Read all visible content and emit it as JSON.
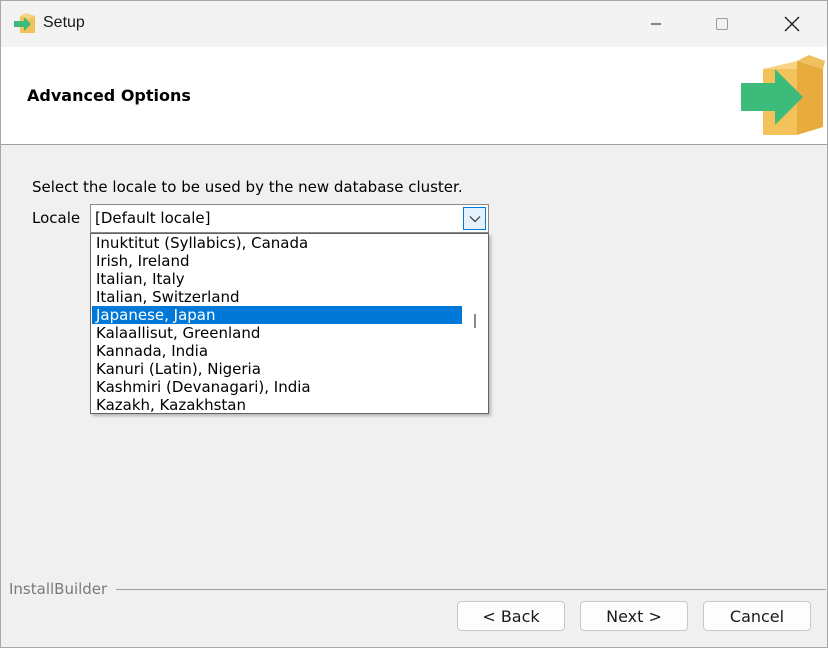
{
  "window": {
    "title": "Setup",
    "app_icon": "installer-box-arrow-icon",
    "controls": {
      "minimize": "minimize-icon",
      "maximize": "maximize-icon",
      "close": "close-icon"
    }
  },
  "header": {
    "title": "Advanced Options",
    "logo": "installer-box-arrow-logo"
  },
  "body": {
    "prompt": "Select the locale to be used by the new database cluster.",
    "locale_label": "Locale",
    "locale_value": "[Default locale]",
    "dropdown_items": [
      "Inuktitut (Syllabics), Canada",
      "Irish, Ireland",
      "Italian, Italy",
      "Italian, Switzerland",
      "Japanese, Japan",
      "Kalaallisut, Greenland",
      "Kannada, India",
      "Kanuri (Latin), Nigeria",
      "Kashmiri (Devanagari), India",
      "Kazakh, Kazakhstan"
    ],
    "selected_item": "Japanese, Japan"
  },
  "footer": {
    "brand": "InstallBuilder",
    "back_label": "< Back",
    "next_label": "Next >",
    "cancel_label": "Cancel"
  },
  "colors": {
    "selection": "#0078d7",
    "logo_green": "#3dbb7a",
    "logo_box": "#f3c25a"
  }
}
